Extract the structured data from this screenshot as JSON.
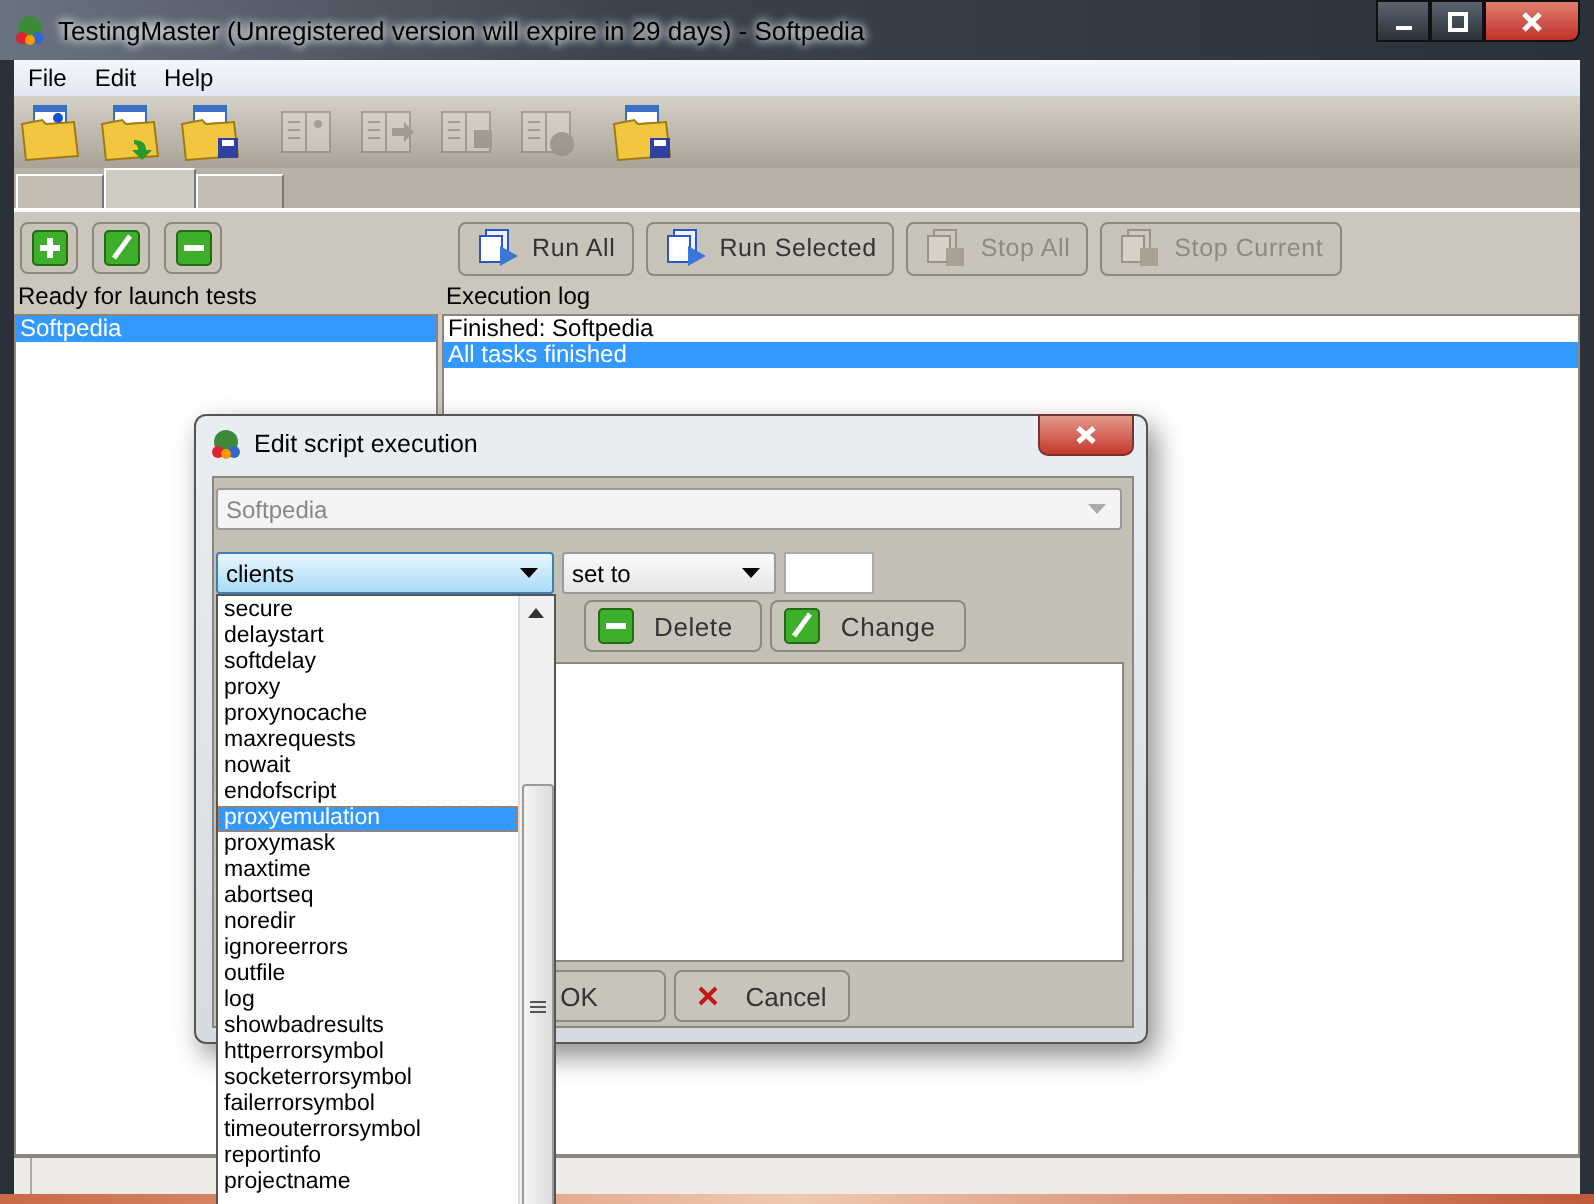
{
  "window": {
    "title": "TestingMaster (Unregistered version will expire in 29 days) - Softpedia"
  },
  "menu": [
    "File",
    "Edit",
    "Help"
  ],
  "toolbar": [
    {
      "kind": "new",
      "disabled": false
    },
    {
      "kind": "open",
      "disabled": false
    },
    {
      "kind": "save",
      "disabled": false
    },
    {
      "kind": "new-item",
      "disabled": true
    },
    {
      "kind": "import",
      "disabled": true
    },
    {
      "kind": "export",
      "disabled": true
    },
    {
      "kind": "delete",
      "disabled": true
    },
    {
      "kind": "save-all",
      "disabled": false
    }
  ],
  "tabs": [
    {
      "selected": false
    },
    {
      "selected": true
    },
    {
      "selected": false
    }
  ],
  "tests_panel": {
    "buttons": [
      {
        "kind": "add"
      },
      {
        "kind": "edit"
      },
      {
        "kind": "remove"
      }
    ],
    "label": "Ready for launch tests",
    "items": [
      {
        "text": "Softpedia",
        "selected": true
      }
    ]
  },
  "log_panel": {
    "buttons": [
      {
        "label": "Run All",
        "kind": "run-all",
        "disabled": false
      },
      {
        "label": "Run Selected",
        "kind": "run-selected",
        "disabled": false
      },
      {
        "label": "Stop All",
        "kind": "stop-all",
        "disabled": true
      },
      {
        "label": "Stop Current",
        "kind": "stop-current",
        "disabled": true
      }
    ],
    "label": "Execution log",
    "lines": [
      {
        "text": "Finished: Softpedia",
        "selected": false
      },
      {
        "text": "All tasks finished",
        "selected": true
      }
    ]
  },
  "dialog": {
    "title": "Edit script execution",
    "script": {
      "value": "Softpedia",
      "disabled": true
    },
    "parameter": {
      "value": "clients",
      "focused": true
    },
    "operator": {
      "value": "set to"
    },
    "buttons": [
      {
        "label": "Delete",
        "kind": "delete"
      },
      {
        "label": "Change",
        "kind": "change"
      }
    ],
    "footer_buttons": [
      {
        "label": "OK",
        "kind": "ok"
      },
      {
        "label": "Cancel",
        "kind": "cancel"
      }
    ],
    "dropdown": {
      "items": [
        {
          "text": "secure",
          "selected": false
        },
        {
          "text": "delaystart",
          "selected": false
        },
        {
          "text": "softdelay",
          "selected": false
        },
        {
          "text": "proxy",
          "selected": false
        },
        {
          "text": "proxynocache",
          "selected": false
        },
        {
          "text": "maxrequests",
          "selected": false
        },
        {
          "text": "nowait",
          "selected": false
        },
        {
          "text": "endofscript",
          "selected": false
        },
        {
          "text": "proxyemulation",
          "selected": true
        },
        {
          "text": "proxymask",
          "selected": false
        },
        {
          "text": "maxtime",
          "selected": false
        },
        {
          "text": "abortseq",
          "selected": false
        },
        {
          "text": "noredir",
          "selected": false
        },
        {
          "text": "ignoreerrors",
          "selected": false
        },
        {
          "text": "outfile",
          "selected": false
        },
        {
          "text": "log",
          "selected": false
        },
        {
          "text": "showbadresults",
          "selected": false
        },
        {
          "text": "httperrorsymbol",
          "selected": false
        },
        {
          "text": "socketerrorsymbol",
          "selected": false
        },
        {
          "text": "failerrorsymbol",
          "selected": false
        },
        {
          "text": "timeouterrorsymbol",
          "selected": false
        },
        {
          "text": "reportinfo",
          "selected": false
        },
        {
          "text": "projectname",
          "selected": false
        }
      ]
    }
  }
}
